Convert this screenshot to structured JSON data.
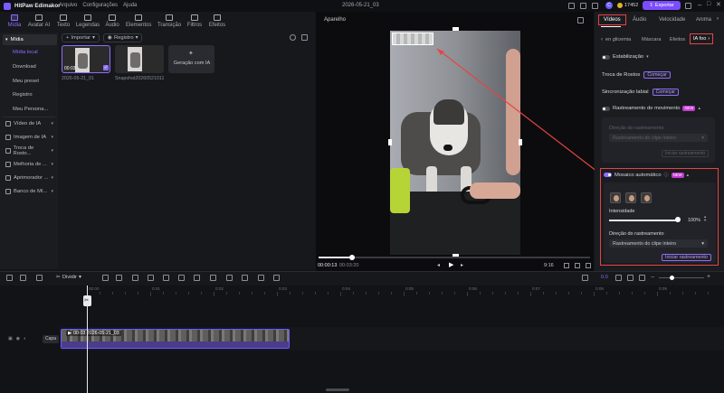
{
  "titlebar": {
    "app_name": "HitPaw Edimakor",
    "menu": [
      "Arquivo",
      "Configurações",
      "Ajuda"
    ],
    "project_name": "2026-05-21_03",
    "credits": "17452",
    "avatar_letter": "C",
    "export_label": "Exportar"
  },
  "toolbar": {
    "tools": [
      {
        "label": "Mídia",
        "icon": "media-icon",
        "active": true
      },
      {
        "label": "Avatar AI",
        "icon": "avatar-icon",
        "active": false
      },
      {
        "label": "Texto",
        "icon": "text-icon",
        "active": false
      },
      {
        "label": "Legendas",
        "icon": "subtitles-icon",
        "active": false
      },
      {
        "label": "Áudio",
        "icon": "audio-icon",
        "active": false
      },
      {
        "label": "Elementos",
        "icon": "elements-icon",
        "active": false
      },
      {
        "label": "Transição",
        "icon": "transition-icon",
        "active": false
      },
      {
        "label": "Filtros",
        "icon": "filters-icon",
        "active": false
      },
      {
        "label": "Efeitos",
        "icon": "effects-icon",
        "active": false
      }
    ]
  },
  "sidebar": {
    "media_label": "Mídia",
    "sub_items": [
      "Mídia local",
      "Download",
      "Meu preset",
      "Registro",
      "Meu Persona..."
    ],
    "groups": [
      "Vídeo de IA",
      "Imagem de IA",
      "Troca de Rosto...",
      "Melhoria de ...",
      "Aprimorador ...",
      "Banco de Mí..."
    ]
  },
  "media": {
    "import_label": "Importar",
    "record_label": "Registro",
    "clips": [
      {
        "name": "2026-05-21_01",
        "duration": "00:03"
      },
      {
        "name": "Snapshot20260521011..."
      }
    ],
    "ai_card_label": "Geração com IA"
  },
  "preview": {
    "title": "Aparelho",
    "time_current": "00:00:13",
    "time_total": "00:03:20",
    "aspect": "9:16"
  },
  "right_panel": {
    "tabs": [
      "Vídeos",
      "Áudio",
      "Velocidade",
      "Anima"
    ],
    "subtabs": [
      "en glicemia",
      "Máscara",
      "Efeitos",
      "IA foo"
    ],
    "stabilize_label": "Estabilização",
    "face_swap_label": "Troca de Rostos",
    "face_swap_btn": "Começar",
    "lipsync_label": "Sincronização labial",
    "lipsync_btn": "Começar",
    "motion_track_label": "Rastreamento de movimento",
    "motion_dir_label": "Direção do rastreamento",
    "motion_dir_value": "Rastreamento do clipe inteiro",
    "motion_btn": "Iniciar rastreamento",
    "mosaic_label": "Mosaico automático",
    "new_badge": "NEW",
    "intensity_label": "Intensidade",
    "intensity_value": "100%",
    "intensity_fraction": 1.0,
    "track_dir_label": "Direção do rastreamento",
    "track_dir_value": "Rastreamento do clipe inteiro",
    "start_btn": "Iniciar rastreamento"
  },
  "timeline": {
    "split_label": "Dividir",
    "zoom_label": "0.0",
    "ruler": [
      "00:00",
      "0:01",
      "0:02",
      "0:03",
      "0:04",
      "0:05",
      "0:06",
      "0:07",
      "0:08",
      "0:09",
      "0:10"
    ],
    "track_label": "Capa",
    "clip_label": "00:03 2026-05-21_03"
  },
  "colors": {
    "accent": "#8f6dff",
    "highlight_red": "#e64444",
    "export": "#7b4dff"
  }
}
